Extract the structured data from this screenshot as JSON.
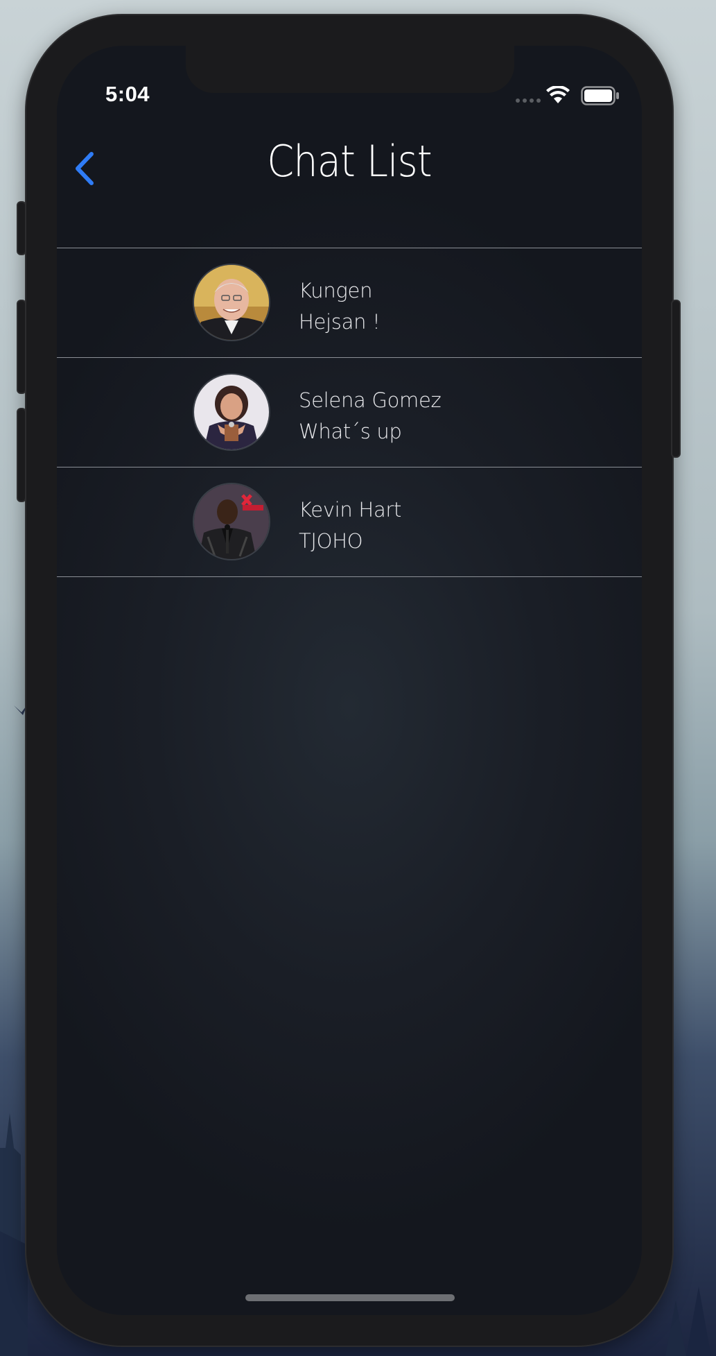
{
  "status_bar": {
    "time": "5:04",
    "wifi_icon": "wifi-icon",
    "battery_icon": "battery-icon"
  },
  "nav": {
    "title": "Chat List",
    "back_icon": "chevron-left-icon",
    "accent_color": "#2f7cf6"
  },
  "chats": [
    {
      "name": "Kungen",
      "message": "Hejsan !",
      "avatar": "avatar-photo"
    },
    {
      "name": "Selena Gomez",
      "message": "What´s up",
      "avatar": "avatar-photo"
    },
    {
      "name": "Kevin Hart",
      "message": "TJOHO",
      "avatar": "avatar-photo"
    }
  ],
  "colors": {
    "background": "#1a1e26",
    "divider": "#8b8f96",
    "text": "#e8e9ec"
  }
}
